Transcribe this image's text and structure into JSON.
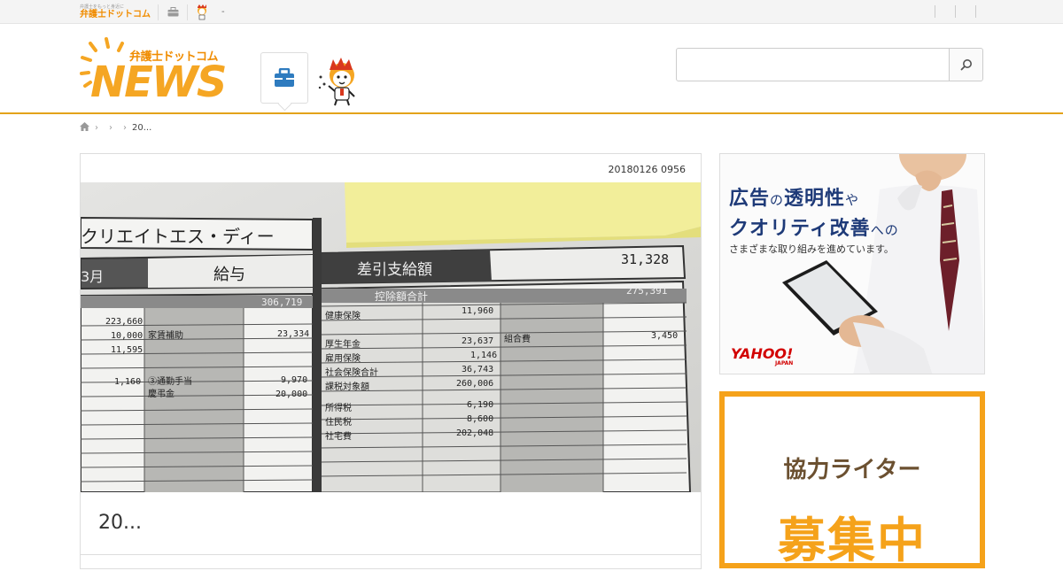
{
  "topbar": {
    "logo_tagline": "弁護士をもっと身近に",
    "logo_text": "弁護士ドットコム",
    "dash": "-"
  },
  "header": {
    "logo_jp": "弁護士ドットコム",
    "logo_news": "NEWS",
    "search_placeholder": ""
  },
  "breadcrumb": {
    "current": "20..."
  },
  "article": {
    "date": "20180126 0956",
    "title": "20...",
    "photo": {
      "company": "クリエイトエス・ディー",
      "month": "3月",
      "pay_label": "給与",
      "net_label": "差引支給額",
      "net_value": "31,328",
      "deduction_label": "控除額合計",
      "deduction_value": "275,391",
      "gross_value": "306,719",
      "left_values": [
        "223,660",
        "10,000",
        "11,595",
        "1,160"
      ],
      "left_labels": [
        "家賃補助",
        "③通勤手当",
        "慶弔金"
      ],
      "left_right_values": [
        "23,334",
        "9,970",
        "20,000"
      ],
      "deductions": [
        {
          "label": "健康保険",
          "value": "11,960"
        },
        {
          "label": "厚生年金",
          "value": "23,637"
        },
        {
          "label": "雇用保険",
          "value": "1,146"
        },
        {
          "label": "社会保険合計",
          "value": "36,743"
        },
        {
          "label": "課税対象額",
          "value": "260,006"
        },
        {
          "label": "所得税",
          "value": "6,190"
        },
        {
          "label": "住民税",
          "value": "8,600"
        },
        {
          "label": "社宅費",
          "value": "202,048"
        }
      ],
      "union_label": "組合費",
      "union_value": "3,450"
    }
  },
  "sidebar": {
    "ad1": {
      "line1_a": "広告",
      "line1_b": "の",
      "line1_c": "透明性",
      "line1_d": "や",
      "line2_a": "クオリティ改善",
      "line2_b": "への",
      "sub": "さまざまな取り組みを進めています。",
      "brand": "YAHOO!",
      "brand_sub": "JAPAN"
    },
    "ad2": {
      "line1": "協力ライター",
      "line2": "募集中"
    }
  },
  "colors": {
    "accent": "#e3a21a",
    "logo_orange": "#f5a623",
    "nav_blue": "#2e7bbf",
    "ad_navy": "#1e3a78",
    "yahoo_red": "#d20000"
  }
}
